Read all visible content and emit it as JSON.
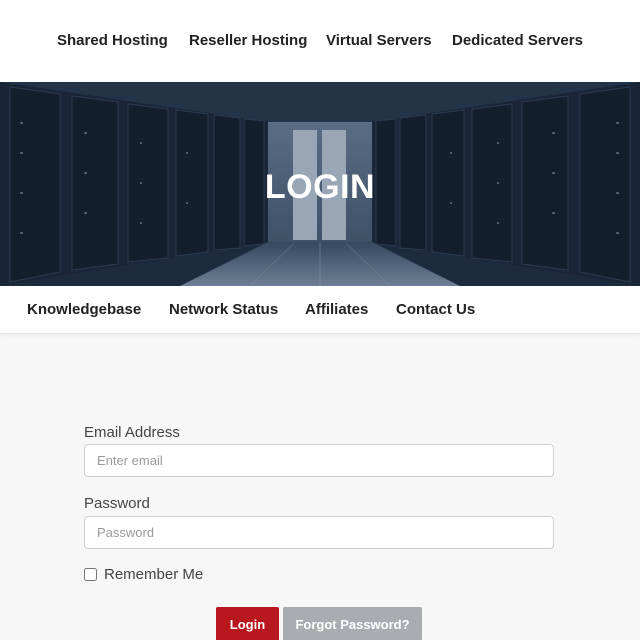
{
  "top_nav": {
    "items": [
      "Shared Hosting",
      "Reseller Hosting",
      "Virtual Servers",
      "Dedicated Servers"
    ]
  },
  "hero": {
    "title": "LOGIN"
  },
  "sub_nav": {
    "items": [
      "Knowledgebase",
      "Network Status",
      "Affiliates",
      "Contact Us"
    ]
  },
  "login_form": {
    "email_label": "Email Address",
    "email_placeholder": "Enter email",
    "email_value": "",
    "password_label": "Password",
    "password_placeholder": "Password",
    "password_value": "",
    "remember_label": "Remember Me",
    "remember_checked": false,
    "login_button": "Login",
    "forgot_button": "Forgot Password?"
  },
  "colors": {
    "hero_background": "#1f2c3c",
    "login_button": "#b8181d",
    "forgot_button": "#a9acb1"
  }
}
